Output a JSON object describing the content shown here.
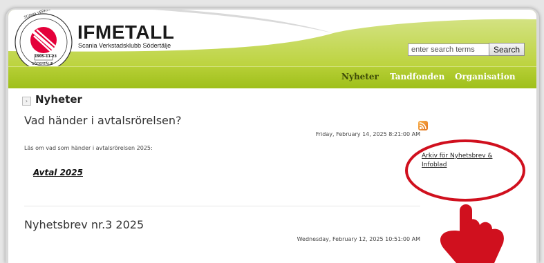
{
  "logo": {
    "title": "IFMETALL",
    "subtitle": "Scania Verkstadsklubb Södertälje",
    "seal_top_text": "SCANIA VERKSTADSKLUBB",
    "seal_bottom_text": "SÖDERTÄLJE",
    "seal_date": "1905-11-23"
  },
  "search": {
    "placeholder": "enter search terms",
    "button_label": "Search"
  },
  "nav": {
    "items": [
      {
        "label": "Nyheter",
        "active": true
      },
      {
        "label": "Tandfonden",
        "active": false
      },
      {
        "label": "Organisation",
        "active": false
      }
    ]
  },
  "section": {
    "title": "Nyheter"
  },
  "articles": [
    {
      "title": "Vad händer i avtalsrörelsen?",
      "date": "Friday, February 14, 2025 8:21:00 AM",
      "body": "Läs om vad som händer i avtalsrörelsen 2025:",
      "link": "Avtal 2025"
    },
    {
      "title": "Nyhetsbrev nr.3 2025",
      "date": "Wednesday, February 12, 2025 10:51:00 AM"
    }
  ],
  "sidebar": {
    "rss_icon": "rss-icon",
    "archive_link_line1": "Arkiv för Nyhetsbrev &",
    "archive_link_line2": "Infoblad"
  },
  "colors": {
    "header_green": "#b2cd2e",
    "nav_active": "#3d4a07",
    "annotation_red": "#d0101e"
  }
}
